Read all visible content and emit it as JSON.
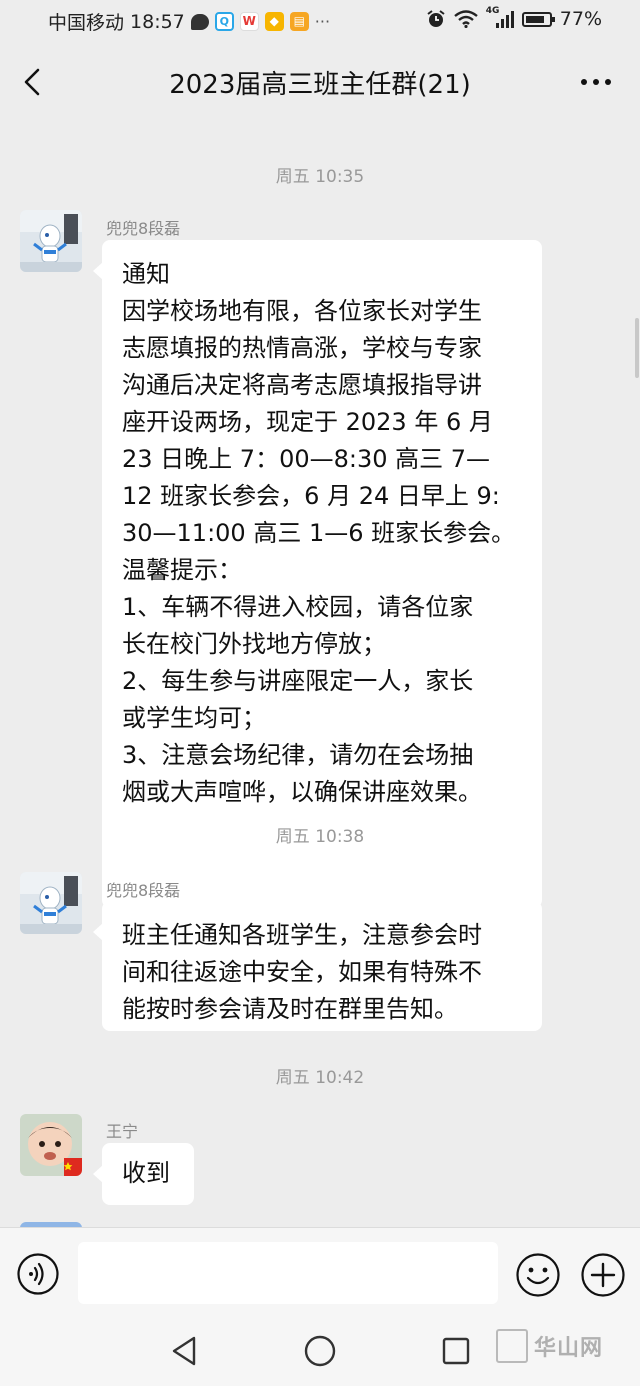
{
  "status_bar": {
    "carrier": "中国移动",
    "time": "18:57",
    "network_label": "4G",
    "battery_percent": "77%",
    "battery_level": 0.77,
    "app_icons": [
      "message-icon",
      "qq-icon",
      "wps-icon",
      "shield-app-icon",
      "notes-app-icon"
    ],
    "more_glyph": "···"
  },
  "header": {
    "title": "2023届高三班主任群(21)",
    "back_icon": "chevron-left-icon",
    "more_icon": "more-dots-icon"
  },
  "messages": [
    {
      "timestamp": "周五 10:35",
      "sender": "兜兜8段磊",
      "lines": [
        "通知",
        "因学校场地有限，各位家长对学生",
        "志愿填报的热情高涨，学校与专家",
        "沟通后决定将高考志愿填报指导讲",
        "座开设两场，现定于 2023 年 6 月",
        "23 日晚上 7：00—8:30 高三 7—",
        "12 班家长参会，6 月 24 日早上 9:",
        "30—11:00 高三 1—6 班家长参会。",
        "温馨提示：",
        "1、车辆不得进入校园，请各位家",
        "长在校门外找地方停放；",
        "2、每生参与讲座限定一人，家长",
        "或学生均可；",
        "3、注意会场纪律，请勿在会场抽",
        "烟或大声喧哗，以确保讲座效果。"
      ]
    },
    {
      "timestamp": "周五 10:38",
      "sender": "兜兜8段磊",
      "lines": [
        "班主任通知各班学生，注意参会时",
        "间和往返途中安全，如果有特殊不",
        "能按时参会请及时在群里告知。"
      ]
    },
    {
      "timestamp": "周五 10:42",
      "sender": "王宁",
      "lines": [
        "收到"
      ]
    }
  ],
  "input_bar": {
    "text_value": "",
    "voice_icon": "voice-icon",
    "emoji_icon": "emoji-icon",
    "plus_icon": "plus-icon"
  },
  "nav_bar": {
    "icons": [
      "nav-back-icon",
      "nav-home-icon",
      "nav-recent-icon"
    ],
    "watermark": "华山网"
  },
  "colors": {
    "background": "#ededed",
    "bubble": "#ffffff",
    "timestamp": "#999999",
    "sender": "#8a8a8a"
  }
}
